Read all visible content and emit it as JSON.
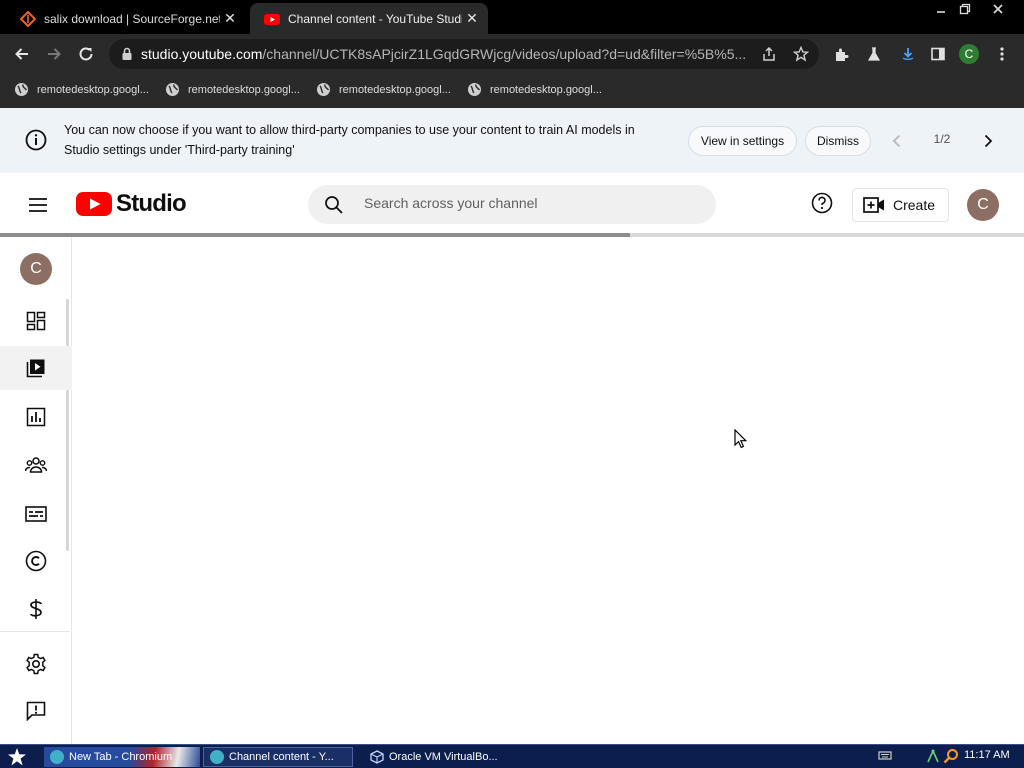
{
  "browser": {
    "tabs": [
      {
        "title": "salix download | SourceForge.net",
        "favicon": "sourceforge-icon",
        "active": false
      },
      {
        "title": "Channel content - YouTube Studio",
        "favicon": "youtube-icon",
        "active": true
      }
    ],
    "close_glyph": "✕",
    "address": {
      "host": "studio.youtube.com",
      "path": "/channel/UCTK8sAPjcirZ1LGqdGRWjcg/videos/upload?d=ud&filter=%5B%5..."
    },
    "profile_initial": "C",
    "bookmarks": [
      {
        "label": "remotedesktop.googl..."
      },
      {
        "label": "remotedesktop.googl..."
      },
      {
        "label": "remotedesktop.googl..."
      },
      {
        "label": "remotedesktop.googl..."
      }
    ]
  },
  "banner": {
    "message": "You can now choose if you want to allow third-party companies to use your content to train AI models in Studio settings under 'Third-party training'",
    "view_settings_label": "View in settings",
    "dismiss_label": "Dismiss",
    "pagination": "1/2"
  },
  "header": {
    "logo_text": "Studio",
    "search_placeholder": "Search across your channel",
    "create_label": "Create",
    "avatar_initial": "C"
  },
  "loading_progress": 0.615,
  "sidebar": {
    "avatar_initial": "C",
    "items": [
      {
        "name": "dashboard",
        "icon": "dashboard-icon",
        "active": false
      },
      {
        "name": "content",
        "icon": "content-icon",
        "active": true
      },
      {
        "name": "analytics",
        "icon": "analytics-icon",
        "active": false
      },
      {
        "name": "community",
        "icon": "community-icon",
        "active": false
      },
      {
        "name": "subtitles",
        "icon": "subtitles-icon",
        "active": false
      },
      {
        "name": "copyright",
        "icon": "copyright-icon",
        "active": false
      },
      {
        "name": "earn",
        "icon": "earn-icon",
        "active": false
      }
    ],
    "bottom_items": [
      {
        "name": "settings",
        "icon": "gear-icon"
      },
      {
        "name": "feedback",
        "icon": "feedback-icon"
      }
    ]
  },
  "taskbar": {
    "items": [
      {
        "label": "New Tab - Chromium"
      },
      {
        "label": "Channel content - Y..."
      },
      {
        "label": "Oracle VM VirtualBo..."
      }
    ],
    "clock": "11:17 AM"
  },
  "colors": {
    "youtube_red": "#ff0000",
    "banner_bg": "#eef3f8",
    "avatar_bg": "#8d6e63",
    "profile_green": "#2f7d32",
    "taskbar_bg": "#0b1e4e"
  }
}
